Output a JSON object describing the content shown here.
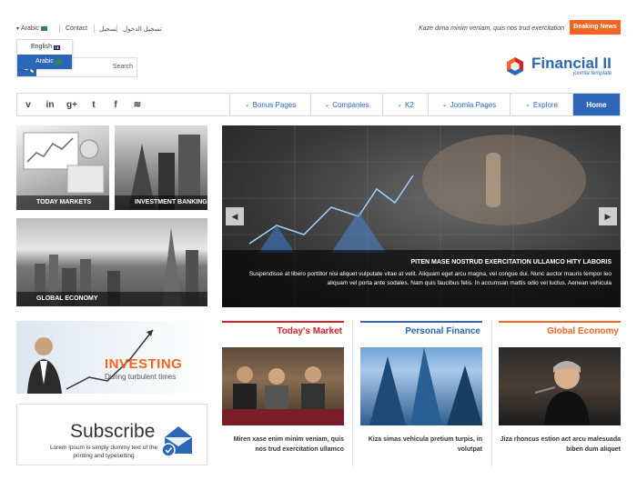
{
  "topbar": {
    "language": "Arabic",
    "links": [
      "Contact",
      "تسجيل",
      "تسجيل الدخول"
    ],
    "ticker": "Kaze dima minim veniam, quis nos trud exercitation",
    "breaking": "Beaking News"
  },
  "language_menu": {
    "options": [
      {
        "label": "English",
        "flag": "uk-flag-icon"
      },
      {
        "label": "Arabic",
        "flag": "saudi-flag-icon",
        "active": true
      }
    ]
  },
  "search": {
    "label": "Search"
  },
  "logo": {
    "title": "Financial II",
    "tagline": "joomla template"
  },
  "social": [
    "vimeo-icon",
    "linkedin-icon",
    "google-plus-icon",
    "twitter-icon",
    "facebook-icon",
    "rss-icon"
  ],
  "social_glyphs": [
    "v",
    "in",
    "g+",
    "t",
    "f",
    "≋"
  ],
  "nav": {
    "items": [
      "Bonus Pages",
      "Companies",
      "K2",
      "Joomla Pages",
      "Explore"
    ],
    "home": "Home"
  },
  "thumbs": {
    "markets": "TODAY MARKETS",
    "banking": "INVESTMENT BANKING",
    "global": "GLOBAL ECONOMY"
  },
  "slider": {
    "title": "PITEN MASE NOSTRUD EXERCITATION ULLAMCO HITY LABORIS",
    "text": "Suspendisse at libero porttitor nisi aliquet vulputate vitae at velit. Aliquam eget arcu magna, vel congue dui. Nunc auctor mauris tempor leo aliquam vel porta ante sodales. Nam quis faucibus felis. In accumsan mattis odio vel luctus. Aenean vehicula"
  },
  "investing": {
    "title": "INVESTING",
    "subtitle": "During turbulent times"
  },
  "subscribe": {
    "title": "Subscribe",
    "text": "Lorem Ipsum is simply dummy text of the printing and typesetting"
  },
  "categories": [
    {
      "title": "Today's Market",
      "color": "#d3222a",
      "text": "Miren xase enim minim veniam, quis nos trud exercitation ullamco"
    },
    {
      "title": "Personal Finance",
      "color": "#2c66b6",
      "text": "Kiza simas vehicula pretium turpis, in volutpat"
    },
    {
      "title": "Global Economy",
      "color": "#f26522",
      "text": "Jiza rhoncus estion act arcu malesuada biben dum aliquet"
    }
  ],
  "colors": {
    "brand_blue": "#2c66b6",
    "accent_orange": "#f26522",
    "accent_red": "#d3222a"
  }
}
